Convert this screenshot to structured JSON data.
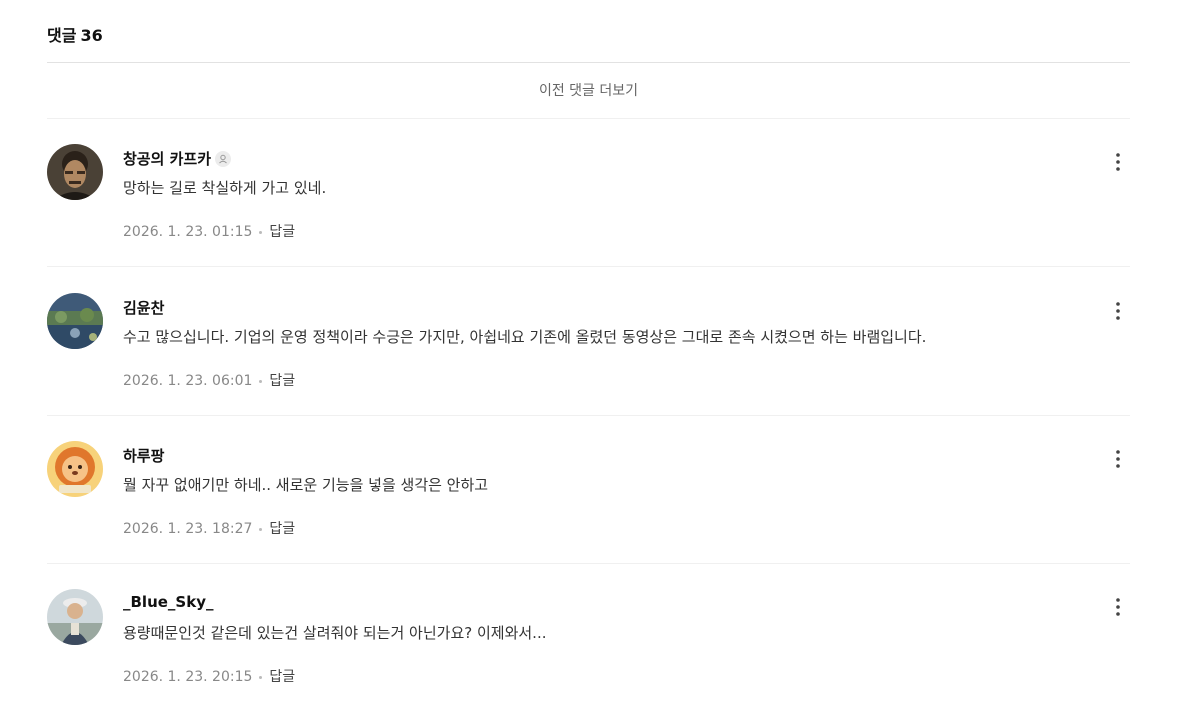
{
  "header": {
    "title": "댓글",
    "count": "36"
  },
  "more_label": "이전 댓글 더보기",
  "comments": [
    {
      "author": "창공의 카프카",
      "text": "망하는 길로 착실하게 가고 있네.",
      "date": "2026. 1. 23. 01:15",
      "reply": "답글",
      "avatar": "portrait-man-icon",
      "creator_badge": "person-icon"
    },
    {
      "author": "김윤찬",
      "text": "수고 많으십니다. 기업의 운영 정책이라 수긍은 가지만, 아쉽네요 기존에 올렸던 동영상은 그대로 존속 시켰으면 하는 바램입니다.",
      "date": "2026. 1. 23. 06:01",
      "reply": "답글",
      "avatar": "landscape-icon"
    },
    {
      "author": "하루팡",
      "text": "뭘 자꾸 없애기만 하네.. 새로운 기능을 넣을 생각은 안하고",
      "date": "2026. 1. 23. 18:27",
      "reply": "답글",
      "avatar": "cartoon-lion-icon"
    },
    {
      "author": "_Blue_Sky_",
      "text": "용량때문인것 같은데 있는건 살려줘야 되는거 아닌가요? 이제와서...",
      "date": "2026. 1. 23. 20:15",
      "reply": "답글",
      "avatar": "hiker-photo-icon"
    }
  ]
}
